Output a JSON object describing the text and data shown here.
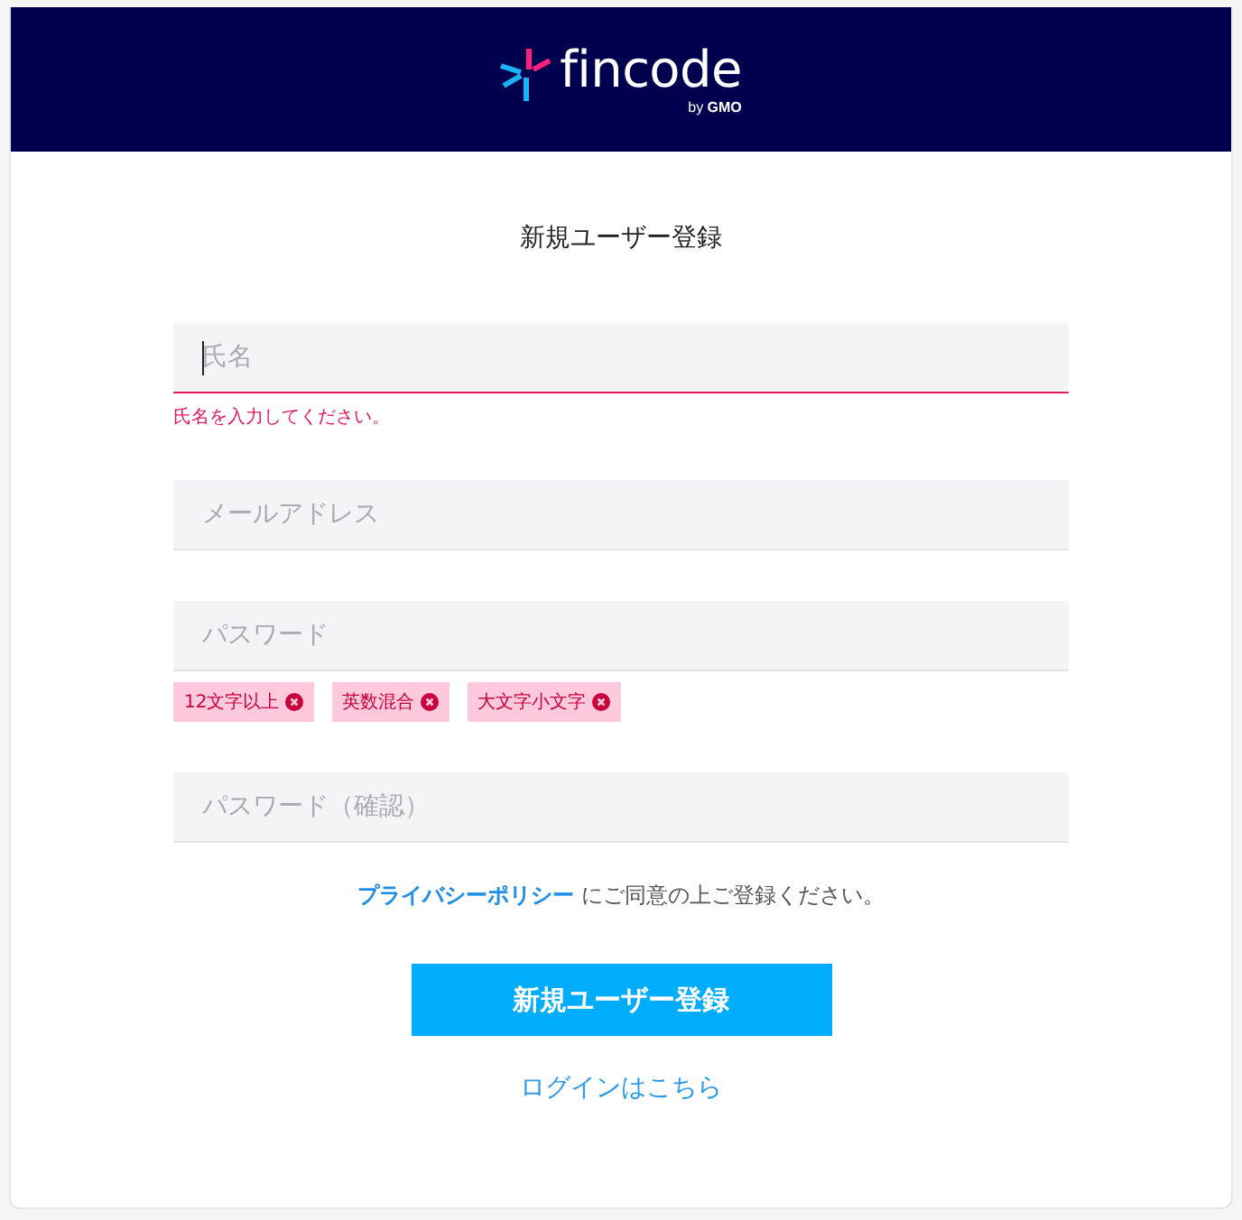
{
  "header": {
    "logo": {
      "name": "fincode",
      "tagline": "by **GMO**"
    }
  },
  "form": {
    "title": "新規ユーザー登録",
    "fields": [
      {
        "placeholder": "氏名",
        "focused": true,
        "error": "氏名を入力してください。"
      },
      {
        "placeholder": "メールアドレス",
        "focused": false
      },
      {
        "placeholder": "パスワード",
        "focused": false,
        "requirements": [
          {
            "label": "12文字以上",
            "met": false
          },
          {
            "label": "英数混合",
            "met": false
          },
          {
            "label": "大文字小文字",
            "met": false
          }
        ]
      },
      {
        "placeholder": "パスワード（確認）",
        "focused": false
      }
    ],
    "consent": {
      "link": "プライバシーポリシー",
      "text": " にご同意の上ご登録ください。"
    },
    "submit_button": "新規ユーザー登録",
    "login_link": "ログインはこちら"
  }
}
